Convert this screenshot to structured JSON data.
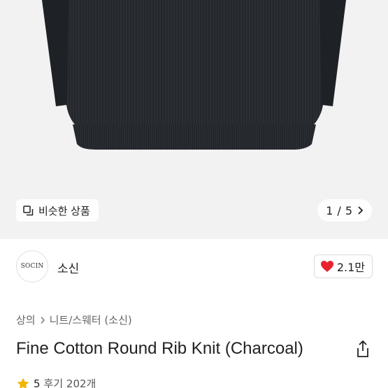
{
  "product_image": {
    "alt_icon": "charcoal-rib-knit-sweater",
    "similar_label": "비슷한 상품",
    "pager": {
      "current": "1",
      "separator": "/",
      "total": "5"
    }
  },
  "brand": {
    "logo_text": "SOCIN",
    "name": "소신"
  },
  "like": {
    "count": "2.1만",
    "color": "#e8222e"
  },
  "breadcrumb": [
    "상의",
    "니트/스웨터 (소신)"
  ],
  "title": "Fine Cotton Round Rib Knit (Charcoal)",
  "rating": {
    "score": "5",
    "reviews": "후기 202개",
    "star_color": "#f4b400"
  },
  "colors": {
    "hero_bg": "#f2f2f2",
    "sweater": "#23262b"
  }
}
